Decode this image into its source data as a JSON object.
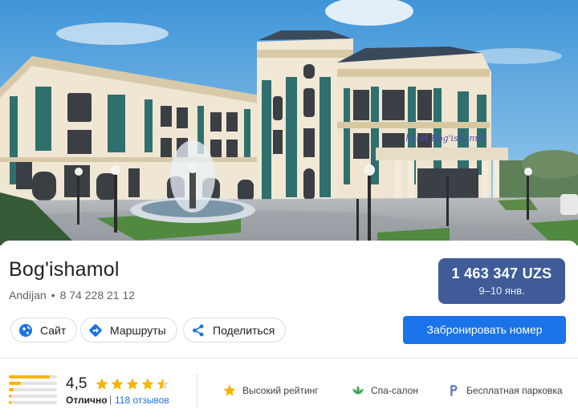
{
  "hero": {
    "signage": "hotel Bog'ishamol"
  },
  "hotel": {
    "name": "Bog'ishamol",
    "city": "Andijan",
    "separator": "•",
    "phone": "8 74 228 21 12"
  },
  "price": {
    "amount": "1 463 347 UZS",
    "dates": "9–10 янв."
  },
  "actions": {
    "site": "Сайт",
    "routes": "Маршруты",
    "share": "Поделиться",
    "book": "Забронировать номер"
  },
  "rating": {
    "score": "4,5",
    "stars": 4.5,
    "label": "Отлично",
    "separator": "|",
    "reviews": "118 отзывов",
    "distribution": [
      0.85,
      0.25,
      0.1,
      0.05,
      0.05
    ]
  },
  "amenities": [
    {
      "label": "Высокий рейтинг",
      "icon": "star-icon"
    },
    {
      "label": "Спа-салон",
      "icon": "spa-icon"
    },
    {
      "label": "Бесплатная парковка",
      "icon": "parking-icon"
    }
  ],
  "colors": {
    "accent": "#1a73e8",
    "price_bg": "#3f5c99",
    "star": "#f6b500",
    "spa": "#34a853"
  }
}
